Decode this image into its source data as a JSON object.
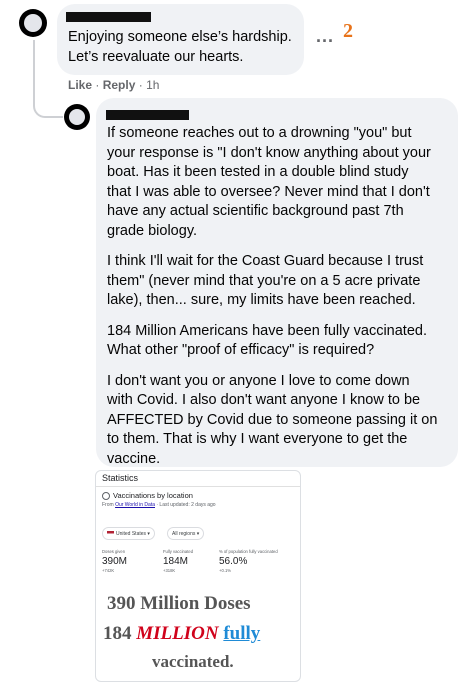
{
  "comment": {
    "text_line1": "Enjoying someone else’s hardship.",
    "text_line2": "Let’s reevaluate our hearts.",
    "more": "...",
    "annotation_number": "2",
    "like": "Like",
    "reply": "Reply",
    "time": "1h",
    "sep": "·"
  },
  "reply": {
    "paragraphs": [
      [
        "If someone reaches out to a drowning \"you\" but",
        "your response is \"I don't know anything about your",
        "boat. Has it been tested in a double blind study",
        "that I was able to oversee? Never mind that I don't",
        "have any actual scientific background past 7th",
        "grade biology."
      ],
      [
        "I think I'll wait for the Coast Guard because I trust",
        "them\" (never mind that you're on a 5 acre private",
        "lake), then... sure, my limits have been reached."
      ],
      [
        "184 Million Americans have been fully vaccinated.",
        "What other \"proof of efficacy\" is required?"
      ],
      [
        "I don't want you or anyone I love to come down",
        "with Covid. I also don't want anyone I know to be",
        "AFFECTED by Covid due to someone passing it on",
        "to them. That is why I want everyone to get the",
        "vaccine."
      ]
    ]
  },
  "image_card": {
    "statistics": "Statistics",
    "heading": "Vaccinations by location",
    "source_prefix": "From",
    "source_name": "Our World in Data",
    "source_suffix": "· Last updated: 2 days ago",
    "country_select": "United States ▾",
    "region_select": "All regions ▾",
    "stats": [
      {
        "label": "Doses given",
        "value": "390M",
        "change": "+742K"
      },
      {
        "label": "Fully vaccinated",
        "value": "184M",
        "change": "+318K"
      },
      {
        "label": "% of population fully vaccinated",
        "value": "56.0%",
        "change": "+0.1%"
      }
    ],
    "caption_line1": "390 Million Doses",
    "caption_184": "184",
    "caption_million": "MILLION",
    "caption_fully": "fully",
    "caption_vaccinated": "vaccinated."
  },
  "colors": {
    "bubble": "#f0f2f5",
    "meta": "#65676b",
    "annotation": "#e8731a",
    "caption_gray": "#555555",
    "caption_red": "#d0021b",
    "caption_blue": "#1f8bd6"
  }
}
